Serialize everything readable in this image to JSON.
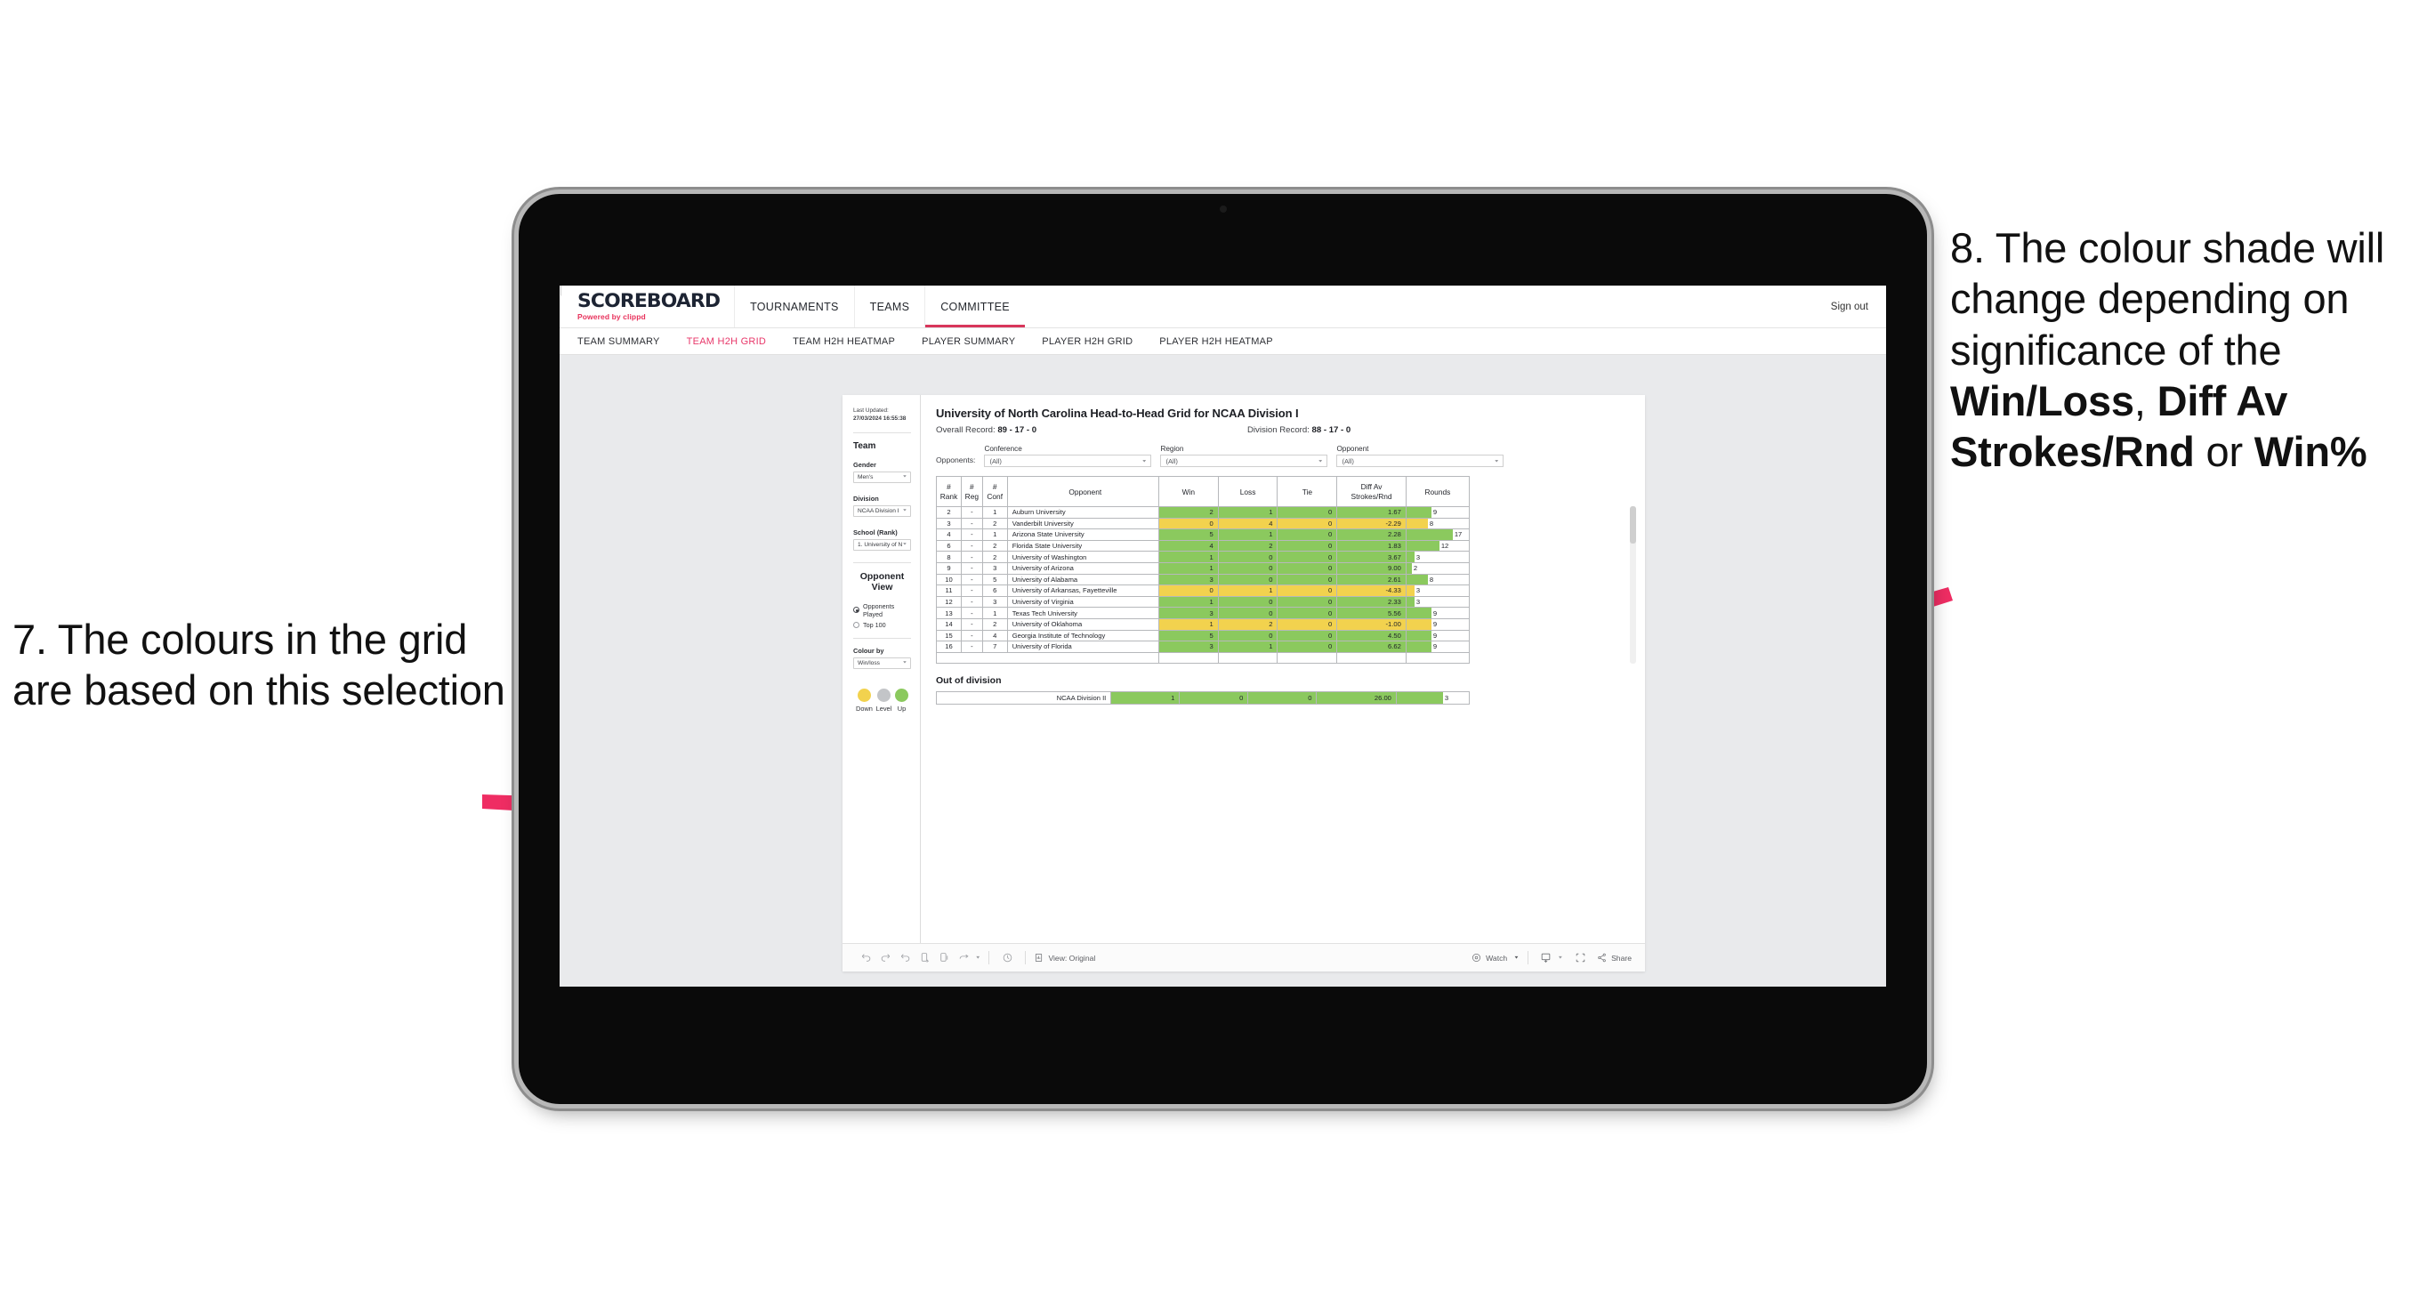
{
  "annotations": {
    "left": {
      "text": "7. The colours in the grid are based on this selection"
    },
    "right": {
      "pre": "8. The colour shade will change depending on significance of the ",
      "bold1": "Win/Loss",
      "mid1": ", ",
      "bold2": "Diff Av Strokes/Rnd",
      "mid2": " or ",
      "bold3": "Win%"
    },
    "arrow_color": "#EF2D63"
  },
  "app": {
    "brand": {
      "name": "SCOREBOARD",
      "powered_prefix": "Powered by ",
      "powered_brand": "clippd"
    },
    "top_nav": [
      {
        "label": "TOURNAMENTS",
        "active": false
      },
      {
        "label": "TEAMS",
        "active": false
      },
      {
        "label": "COMMITTEE",
        "active": true
      }
    ],
    "sign_out": "Sign out",
    "sub_nav": [
      {
        "label": "TEAM SUMMARY",
        "active": false
      },
      {
        "label": "TEAM H2H GRID",
        "active": true
      },
      {
        "label": "TEAM H2H HEATMAP",
        "active": false
      },
      {
        "label": "PLAYER SUMMARY",
        "active": false
      },
      {
        "label": "PLAYER H2H GRID",
        "active": false
      },
      {
        "label": "PLAYER H2H HEATMAP",
        "active": false
      }
    ]
  },
  "sidebar": {
    "last_updated_label": "Last Updated: ",
    "last_updated_value": "27/03/2024 16:55:38",
    "team_heading": "Team",
    "gender_label": "Gender",
    "gender_value": "Men's",
    "division_label": "Division",
    "division_value": "NCAA Division I",
    "school_label": "School (Rank)",
    "school_value": "1. University of Nort...",
    "opponent_view_heading": "Opponent View",
    "opponent_view_options": [
      {
        "label": "Opponents Played",
        "selected": true
      },
      {
        "label": "Top 100",
        "selected": false
      }
    ],
    "colour_by_label": "Colour by",
    "colour_by_value": "Win/loss",
    "legend": [
      {
        "label": "Down",
        "color": "#F2D24E"
      },
      {
        "label": "Level",
        "color": "#C3C5C8"
      },
      {
        "label": "Up",
        "color": "#8BC95E"
      }
    ]
  },
  "viz": {
    "title": "University of North Carolina Head-to-Head Grid for NCAA Division I",
    "overall_record_label": "Overall Record: ",
    "overall_record_value": "89 - 17 - 0",
    "division_record_label": "Division Record: ",
    "division_record_value": "88 - 17 - 0",
    "opponents_label": "Opponents:",
    "filters": [
      {
        "label": "Conference",
        "value": "(All)"
      },
      {
        "label": "Region",
        "value": "(All)"
      },
      {
        "label": "Opponent",
        "value": "(All)"
      }
    ],
    "columns": [
      "# Rank",
      "# Reg",
      "# Conf",
      "Opponent",
      "Win",
      "Loss",
      "Tie",
      "Diff Av Strokes/Rnd",
      "Rounds"
    ],
    "column_lines": {
      "rank_l1": "#",
      "rank_l2": "Rank",
      "reg_l1": "#",
      "reg_l2": "Reg",
      "conf_l1": "#",
      "conf_l2": "Conf",
      "opponent": "Opponent",
      "win": "Win",
      "loss": "Loss",
      "tie": "Tie",
      "diff_l1": "Diff Av",
      "diff_l2": "Strokes/Rnd",
      "rounds": "Rounds"
    },
    "colors": {
      "up": "#8BC95E",
      "down": "#F2D24E",
      "level": "#C3C5C8"
    },
    "rows": [
      {
        "rank": "2",
        "reg": "-",
        "conf": "1",
        "opponent": "Auburn University",
        "win": "2",
        "loss": "1",
        "tie": "0",
        "diff": "1.67",
        "rounds": "9",
        "state": "up"
      },
      {
        "rank": "3",
        "reg": "-",
        "conf": "2",
        "opponent": "Vanderbilt University",
        "win": "0",
        "loss": "4",
        "tie": "0",
        "diff": "-2.29",
        "rounds": "8",
        "state": "down"
      },
      {
        "rank": "4",
        "reg": "-",
        "conf": "1",
        "opponent": "Arizona State University",
        "win": "5",
        "loss": "1",
        "tie": "0",
        "diff": "2.28",
        "rounds": "17",
        "state": "up"
      },
      {
        "rank": "6",
        "reg": "-",
        "conf": "2",
        "opponent": "Florida State University",
        "win": "4",
        "loss": "2",
        "tie": "0",
        "diff": "1.83",
        "rounds": "12",
        "state": "up"
      },
      {
        "rank": "8",
        "reg": "-",
        "conf": "2",
        "opponent": "University of Washington",
        "win": "1",
        "loss": "0",
        "tie": "0",
        "diff": "3.67",
        "rounds": "3",
        "state": "up"
      },
      {
        "rank": "9",
        "reg": "-",
        "conf": "3",
        "opponent": "University of Arizona",
        "win": "1",
        "loss": "0",
        "tie": "0",
        "diff": "9.00",
        "rounds": "2",
        "state": "up"
      },
      {
        "rank": "10",
        "reg": "-",
        "conf": "5",
        "opponent": "University of Alabama",
        "win": "3",
        "loss": "0",
        "tie": "0",
        "diff": "2.61",
        "rounds": "8",
        "state": "up"
      },
      {
        "rank": "11",
        "reg": "-",
        "conf": "6",
        "opponent": "University of Arkansas, Fayetteville",
        "win": "0",
        "loss": "1",
        "tie": "0",
        "diff": "-4.33",
        "rounds": "3",
        "state": "down"
      },
      {
        "rank": "12",
        "reg": "-",
        "conf": "3",
        "opponent": "University of Virginia",
        "win": "1",
        "loss": "0",
        "tie": "0",
        "diff": "2.33",
        "rounds": "3",
        "state": "up"
      },
      {
        "rank": "13",
        "reg": "-",
        "conf": "1",
        "opponent": "Texas Tech University",
        "win": "3",
        "loss": "0",
        "tie": "0",
        "diff": "5.56",
        "rounds": "9",
        "state": "up"
      },
      {
        "rank": "14",
        "reg": "-",
        "conf": "2",
        "opponent": "University of Oklahoma",
        "win": "1",
        "loss": "2",
        "tie": "0",
        "diff": "-1.00",
        "rounds": "9",
        "state": "down"
      },
      {
        "rank": "15",
        "reg": "-",
        "conf": "4",
        "opponent": "Georgia Institute of Technology",
        "win": "5",
        "loss": "0",
        "tie": "0",
        "diff": "4.50",
        "rounds": "9",
        "state": "up"
      },
      {
        "rank": "16",
        "reg": "-",
        "conf": "7",
        "opponent": "University of Florida",
        "win": "3",
        "loss": "1",
        "tie": "0",
        "diff": "6.62",
        "rounds": "9",
        "state": "up"
      }
    ],
    "out_of_division_title": "Out of division",
    "out_of_division_row": {
      "name": "NCAA Division II",
      "win": "1",
      "loss": "0",
      "tie": "0",
      "diff": "26.00",
      "rounds": "3",
      "state": "up"
    }
  },
  "toolbar": {
    "view_label": "View: Original",
    "watch_label": "Watch",
    "share_label": "Share"
  },
  "chart_data": {
    "type": "table",
    "title": "University of North Carolina Head-to-Head Grid for NCAA Division I",
    "columns": [
      "# Rank",
      "# Reg",
      "# Conf",
      "Opponent",
      "Win",
      "Loss",
      "Tie",
      "Diff Av Strokes/Rnd",
      "Rounds"
    ],
    "rows": [
      [
        "2",
        "-",
        "1",
        "Auburn University",
        2,
        1,
        0,
        1.67,
        9
      ],
      [
        "3",
        "-",
        "2",
        "Vanderbilt University",
        0,
        4,
        0,
        -2.29,
        8
      ],
      [
        "4",
        "-",
        "1",
        "Arizona State University",
        5,
        1,
        0,
        2.28,
        17
      ],
      [
        "6",
        "-",
        "2",
        "Florida State University",
        4,
        2,
        0,
        1.83,
        12
      ],
      [
        "8",
        "-",
        "2",
        "University of Washington",
        1,
        0,
        0,
        3.67,
        3
      ],
      [
        "9",
        "-",
        "3",
        "University of Arizona",
        1,
        0,
        0,
        9.0,
        2
      ],
      [
        "10",
        "-",
        "5",
        "University of Alabama",
        3,
        0,
        0,
        2.61,
        8
      ],
      [
        "11",
        "-",
        "6",
        "University of Arkansas, Fayetteville",
        0,
        1,
        0,
        -4.33,
        3
      ],
      [
        "12",
        "-",
        "3",
        "University of Virginia",
        1,
        0,
        0,
        2.33,
        3
      ],
      [
        "13",
        "-",
        "1",
        "Texas Tech University",
        3,
        0,
        0,
        5.56,
        9
      ],
      [
        "14",
        "-",
        "2",
        "University of Oklahoma",
        1,
        2,
        0,
        -1.0,
        9
      ],
      [
        "15",
        "-",
        "4",
        "Georgia Institute of Technology",
        5,
        0,
        0,
        4.5,
        9
      ],
      [
        "16",
        "-",
        "7",
        "University of Florida",
        3,
        1,
        0,
        6.62,
        9
      ]
    ],
    "out_of_division": [
      [
        "NCAA Division II",
        1,
        0,
        0,
        26.0,
        3
      ]
    ],
    "colour_by": "Win/loss",
    "legend": [
      {
        "label": "Down",
        "color": "#F2D24E"
      },
      {
        "label": "Level",
        "color": "#C3C5C8"
      },
      {
        "label": "Up",
        "color": "#8BC95E"
      }
    ],
    "rounds_bar_max": 17,
    "overall_record": "89 - 17 - 0",
    "division_record": "88 - 17 - 0"
  }
}
